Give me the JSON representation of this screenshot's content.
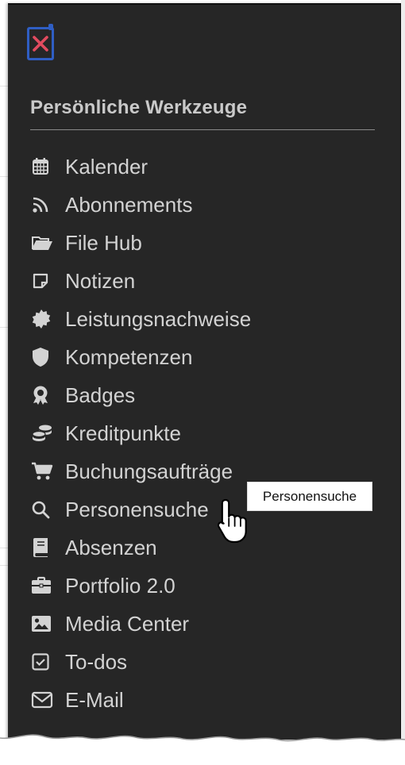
{
  "menu": {
    "heading": "Persönliche Werkzeuge",
    "close_icon": "close-icon",
    "items": [
      {
        "label": "Kalender",
        "icon": "calendar-icon"
      },
      {
        "label": "Abonnements",
        "icon": "rss-icon"
      },
      {
        "label": "File Hub",
        "icon": "folder-open-icon"
      },
      {
        "label": "Notizen",
        "icon": "note-icon"
      },
      {
        "label": "Leistungsnachweise",
        "icon": "certificate-icon"
      },
      {
        "label": "Kompetenzen",
        "icon": "shield-icon"
      },
      {
        "label": "Badges",
        "icon": "award-icon"
      },
      {
        "label": "Kreditpunkte",
        "icon": "coins-icon"
      },
      {
        "label": "Buchungsaufträge",
        "icon": "cart-icon"
      },
      {
        "label": "Personensuche",
        "icon": "search-icon"
      },
      {
        "label": "Absenzen",
        "icon": "book-icon"
      },
      {
        "label": "Portfolio 2.0",
        "icon": "briefcase-icon"
      },
      {
        "label": "Media Center",
        "icon": "image-icon"
      },
      {
        "label": "To-dos",
        "icon": "checkbox-icon"
      },
      {
        "label": "E-Mail",
        "icon": "envelope-icon"
      }
    ]
  },
  "tooltip": {
    "text": "Personensuche"
  },
  "colors": {
    "panel": "#262626",
    "text": "#d3d3d3",
    "close_border": "#2f5ec4",
    "close_x": "#e24b5f"
  }
}
